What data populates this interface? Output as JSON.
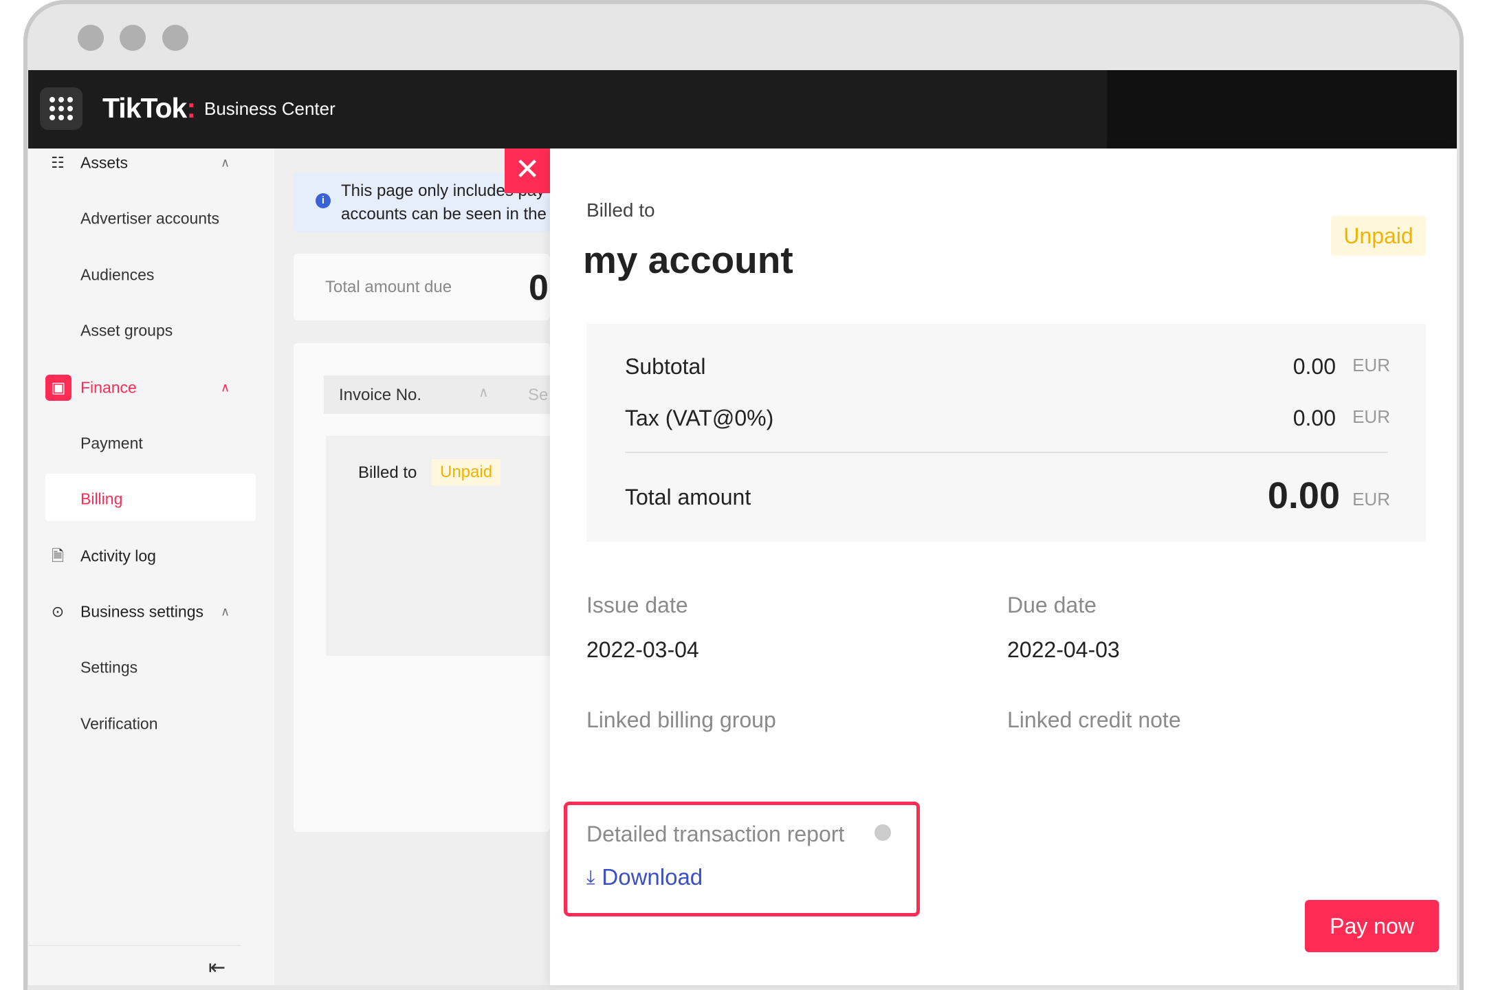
{
  "window": {
    "controls": [
      "close",
      "minimize",
      "maximize"
    ]
  },
  "header": {
    "logo": "TikTok",
    "logo_suffix": ":",
    "product": "Business Center"
  },
  "sidebar": {
    "items": [
      {
        "label": "Assets",
        "icon": "hierarchy-icon",
        "expanded": true
      },
      {
        "label": "Advertiser accounts"
      },
      {
        "label": "Audiences"
      },
      {
        "label": "Asset groups"
      },
      {
        "label": "Finance",
        "icon": "wallet-icon",
        "expanded": true,
        "active": true
      },
      {
        "label": "Payment"
      },
      {
        "label": "Billing",
        "selected": true
      },
      {
        "label": "Activity log",
        "icon": "document-icon"
      },
      {
        "label": "Business settings",
        "icon": "gear-icon",
        "expanded": true
      },
      {
        "label": "Settings"
      },
      {
        "label": "Verification"
      }
    ]
  },
  "main": {
    "notice_line1": "This page only includes pay",
    "notice_line2": "accounts can be seen in the",
    "total_due_label": "Total amount due",
    "total_due_value": "0",
    "table_header": "Invoice No.",
    "table_header_2": "Se",
    "row_billed_to": "Billed to",
    "row_status": "Unpaid"
  },
  "drawer": {
    "billed_to_label": "Billed to",
    "account": "my account",
    "status": "Unpaid",
    "subtotal_label": "Subtotal",
    "subtotal": "0.00",
    "tax_label": "Tax (VAT@0%)",
    "tax": "0.00",
    "total_label": "Total amount",
    "total": "0.00",
    "currency": "EUR",
    "issue_date_label": "Issue date",
    "issue_date": "2022-03-04",
    "due_date_label": "Due date",
    "due_date": "2022-04-03",
    "linked_group_label": "Linked billing group",
    "linked_credit_label": "Linked credit note",
    "report_label": "Detailed transaction report",
    "download_label": "Download",
    "pay_label": "Pay now"
  },
  "colors": {
    "brand": "#fe2c55",
    "link": "#3a4fc8",
    "unpaid": "#f2b300"
  }
}
